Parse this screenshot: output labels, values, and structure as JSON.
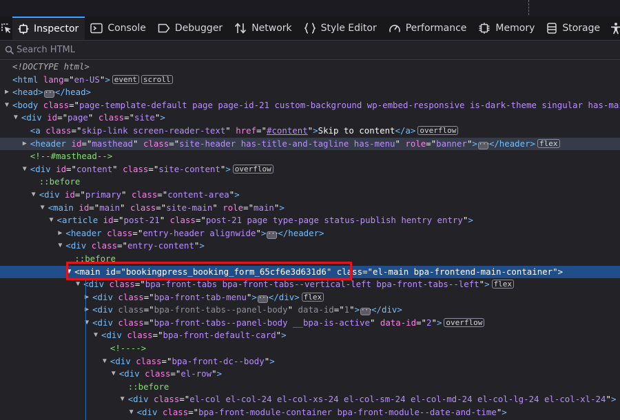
{
  "toolbar": {
    "tabs": [
      {
        "label": "Inspector",
        "icon": "inspector-icon",
        "selected": true
      },
      {
        "label": "Console",
        "icon": "console-icon"
      },
      {
        "label": "Debugger",
        "icon": "debugger-icon"
      },
      {
        "label": "Network",
        "icon": "network-icon"
      },
      {
        "label": "Style Editor",
        "icon": "style-editor-icon"
      },
      {
        "label": "Performance",
        "icon": "performance-icon"
      },
      {
        "label": "Memory",
        "icon": "memory-icon"
      },
      {
        "label": "Storage",
        "icon": "storage-icon"
      }
    ]
  },
  "search": {
    "placeholder": "Search HTML"
  },
  "tree": [
    {
      "indent": 0,
      "twisty": "none",
      "parts": [
        [
          "dt",
          "<!DOCTYPE html>"
        ]
      ]
    },
    {
      "indent": 0,
      "twisty": "none",
      "parts": [
        [
          "tg",
          "<html "
        ],
        [
          "an",
          "lang"
        ],
        [
          "tx",
          "=\""
        ],
        [
          "av",
          "en-US"
        ],
        [
          "tx",
          "\""
        ],
        [
          "tg",
          ">"
        ]
      ],
      "badges": [
        "event",
        "scroll"
      ]
    },
    {
      "indent": 0,
      "twisty": "closed",
      "parts": [
        [
          "tg",
          "<head>"
        ],
        [
          "more",
          ""
        ],
        [
          "tg",
          "</head>"
        ]
      ]
    },
    {
      "indent": 0,
      "twisty": "open",
      "parts": [
        [
          "tg",
          "<body "
        ],
        [
          "an",
          "class"
        ],
        [
          "tx",
          "=\""
        ],
        [
          "av",
          "page-template-default page page-id-21 custom-background wp-embed-responsive is-dark-theme singular has-main-navigation"
        ],
        [
          "tx",
          "\""
        ]
      ]
    },
    {
      "indent": 1,
      "twisty": "open",
      "parts": [
        [
          "tg",
          "<div "
        ],
        [
          "an",
          "id"
        ],
        [
          "tx",
          "=\""
        ],
        [
          "av",
          "page"
        ],
        [
          "tx",
          "\" "
        ],
        [
          "an",
          "class"
        ],
        [
          "tx",
          "=\""
        ],
        [
          "av",
          "site"
        ],
        [
          "tx",
          "\""
        ],
        [
          "tg",
          ">"
        ]
      ]
    },
    {
      "indent": 2,
      "twisty": "none",
      "parts": [
        [
          "tg",
          "<a "
        ],
        [
          "an",
          "class"
        ],
        [
          "tx",
          "=\""
        ],
        [
          "av",
          "skip-link screen-reader-text"
        ],
        [
          "tx",
          "\" "
        ],
        [
          "an",
          "href"
        ],
        [
          "tx",
          "=\""
        ],
        [
          "avu",
          "#content"
        ],
        [
          "tx",
          "\""
        ],
        [
          "tg",
          ">"
        ],
        [
          "tx",
          "Skip to content"
        ],
        [
          "tg",
          "</a>"
        ]
      ],
      "badges": [
        "overflow"
      ]
    },
    {
      "indent": 2,
      "twisty": "closed",
      "hover": true,
      "parts": [
        [
          "tg",
          "<header "
        ],
        [
          "an",
          "id"
        ],
        [
          "tx",
          "=\""
        ],
        [
          "av",
          "masthead"
        ],
        [
          "tx",
          "\" "
        ],
        [
          "an",
          "class"
        ],
        [
          "tx",
          "=\""
        ],
        [
          "av",
          "site-header has-title-and-tagline has-menu"
        ],
        [
          "tx",
          "\" "
        ],
        [
          "an",
          "role"
        ],
        [
          "tx",
          "=\""
        ],
        [
          "av",
          "banner"
        ],
        [
          "tx",
          "\""
        ],
        [
          "tg",
          ">"
        ],
        [
          "more",
          ""
        ],
        [
          "tg",
          "</header>"
        ]
      ],
      "badges": [
        "flex"
      ]
    },
    {
      "indent": 2,
      "twisty": "none",
      "parts": [
        [
          "cm",
          "<!--#masthead-->"
        ]
      ]
    },
    {
      "indent": 2,
      "twisty": "open",
      "parts": [
        [
          "tg",
          "<div "
        ],
        [
          "an",
          "id"
        ],
        [
          "tx",
          "=\""
        ],
        [
          "av",
          "content"
        ],
        [
          "tx",
          "\" "
        ],
        [
          "an",
          "class"
        ],
        [
          "tx",
          "=\""
        ],
        [
          "av",
          "site-content"
        ],
        [
          "tx",
          "\""
        ],
        [
          "tg",
          ">"
        ]
      ],
      "badges": [
        "overflow"
      ]
    },
    {
      "indent": 3,
      "twisty": "none",
      "parts": [
        [
          "ps",
          "::before"
        ]
      ]
    },
    {
      "indent": 3,
      "twisty": "open",
      "parts": [
        [
          "tg",
          "<div "
        ],
        [
          "an",
          "id"
        ],
        [
          "tx",
          "=\""
        ],
        [
          "av",
          "primary"
        ],
        [
          "tx",
          "\" "
        ],
        [
          "an",
          "class"
        ],
        [
          "tx",
          "=\""
        ],
        [
          "av",
          "content-area"
        ],
        [
          "tx",
          "\""
        ],
        [
          "tg",
          ">"
        ]
      ]
    },
    {
      "indent": 4,
      "twisty": "open",
      "parts": [
        [
          "tg",
          "<main "
        ],
        [
          "an",
          "id"
        ],
        [
          "tx",
          "=\""
        ],
        [
          "av",
          "main"
        ],
        [
          "tx",
          "\" "
        ],
        [
          "an",
          "class"
        ],
        [
          "tx",
          "=\""
        ],
        [
          "av",
          "site-main"
        ],
        [
          "tx",
          "\" "
        ],
        [
          "an",
          "role"
        ],
        [
          "tx",
          "=\""
        ],
        [
          "av",
          "main"
        ],
        [
          "tx",
          "\""
        ],
        [
          "tg",
          ">"
        ]
      ]
    },
    {
      "indent": 5,
      "twisty": "open",
      "parts": [
        [
          "tg",
          "<article "
        ],
        [
          "an",
          "id"
        ],
        [
          "tx",
          "=\""
        ],
        [
          "av",
          "post-21"
        ],
        [
          "tx",
          "\" "
        ],
        [
          "an",
          "class"
        ],
        [
          "tx",
          "=\""
        ],
        [
          "av",
          "post-21 page type-page status-publish hentry entry"
        ],
        [
          "tx",
          "\""
        ],
        [
          "tg",
          ">"
        ]
      ]
    },
    {
      "indent": 6,
      "twisty": "closed",
      "parts": [
        [
          "tg",
          "<header "
        ],
        [
          "an",
          "class"
        ],
        [
          "tx",
          "=\""
        ],
        [
          "av",
          "entry-header alignwide"
        ],
        [
          "tx",
          "\""
        ],
        [
          "tg",
          ">"
        ],
        [
          "more",
          ""
        ],
        [
          "tg",
          "</header>"
        ]
      ]
    },
    {
      "indent": 6,
      "twisty": "open",
      "parts": [
        [
          "tg",
          "<div "
        ],
        [
          "an",
          "class"
        ],
        [
          "tx",
          "=\""
        ],
        [
          "av",
          "entry-content"
        ],
        [
          "tx",
          "\""
        ],
        [
          "tg",
          ">"
        ]
      ]
    },
    {
      "indent": 7,
      "twisty": "none",
      "parts": [
        [
          "ps",
          "::before"
        ]
      ]
    },
    {
      "indent": 7,
      "twisty": "open",
      "selected": true,
      "parts": [
        [
          "tg",
          "<main "
        ],
        [
          "an",
          "id"
        ],
        [
          "tx",
          "=\""
        ],
        [
          "av",
          "bookingpress_booking_form_65cf6e3d631d6"
        ],
        [
          "tx",
          "\" "
        ],
        [
          "an",
          "class"
        ],
        [
          "tx",
          "=\""
        ],
        [
          "av",
          "el-main bpa-frontend-main-container"
        ],
        [
          "tx",
          "\""
        ],
        [
          "tg",
          ">"
        ]
      ]
    },
    {
      "indent": 8,
      "twisty": "open",
      "parts": [
        [
          "tg",
          "<div "
        ],
        [
          "an",
          "class"
        ],
        [
          "tx",
          "=\""
        ],
        [
          "av",
          "bpa-front-tabs bpa-front-tabs--vertical-left bpa-front-tabs--left"
        ],
        [
          "tx",
          "\""
        ],
        [
          "tg",
          ">"
        ]
      ],
      "badges": [
        "flex"
      ]
    },
    {
      "indent": 9,
      "twisty": "closed",
      "parts": [
        [
          "tg",
          "<div "
        ],
        [
          "an",
          "class"
        ],
        [
          "tx",
          "=\""
        ],
        [
          "av",
          "bpa-front-tab-menu"
        ],
        [
          "tx",
          "\""
        ],
        [
          "tg",
          ">"
        ],
        [
          "more",
          ""
        ],
        [
          "tg",
          "</div>"
        ]
      ],
      "badges": [
        "flex"
      ]
    },
    {
      "indent": 9,
      "twisty": "closed",
      "dim": true,
      "parts": [
        [
          "tg",
          "<div "
        ],
        [
          "an",
          "class"
        ],
        [
          "tx",
          "=\""
        ],
        [
          "av",
          "bpa-front-tabs--panel-body"
        ],
        [
          "tx",
          "\" "
        ],
        [
          "an",
          "data-id"
        ],
        [
          "tx",
          "=\""
        ],
        [
          "av",
          "1"
        ],
        [
          "tx",
          "\""
        ],
        [
          "tg",
          ">"
        ],
        [
          "more",
          ""
        ],
        [
          "tg",
          "</div>"
        ]
      ]
    },
    {
      "indent": 9,
      "twisty": "open",
      "parts": [
        [
          "tg",
          "<div "
        ],
        [
          "an",
          "class"
        ],
        [
          "tx",
          "=\""
        ],
        [
          "av",
          "bpa-front-tabs--panel-body __bpa-is-active"
        ],
        [
          "tx",
          "\" "
        ],
        [
          "an",
          "data-id"
        ],
        [
          "tx",
          "=\""
        ],
        [
          "av",
          "2"
        ],
        [
          "tx",
          "\""
        ],
        [
          "tg",
          ">"
        ]
      ],
      "badges": [
        "overflow"
      ]
    },
    {
      "indent": 10,
      "twisty": "open",
      "parts": [
        [
          "tg",
          "<div "
        ],
        [
          "an",
          "class"
        ],
        [
          "tx",
          "=\""
        ],
        [
          "av",
          "bpa-front-default-card"
        ],
        [
          "tx",
          "\""
        ],
        [
          "tg",
          ">"
        ]
      ]
    },
    {
      "indent": 11,
      "twisty": "none",
      "parts": [
        [
          "cm",
          "<!---->"
        ]
      ]
    },
    {
      "indent": 11,
      "twisty": "open",
      "parts": [
        [
          "tg",
          "<div "
        ],
        [
          "an",
          "class"
        ],
        [
          "tx",
          "=\""
        ],
        [
          "av",
          "bpa-front-dc--body"
        ],
        [
          "tx",
          "\""
        ],
        [
          "tg",
          ">"
        ]
      ]
    },
    {
      "indent": 12,
      "twisty": "open",
      "parts": [
        [
          "tg",
          "<div "
        ],
        [
          "an",
          "class"
        ],
        [
          "tx",
          "=\""
        ],
        [
          "av",
          "el-row"
        ],
        [
          "tx",
          "\""
        ],
        [
          "tg",
          ">"
        ]
      ]
    },
    {
      "indent": 13,
      "twisty": "none",
      "parts": [
        [
          "ps",
          "::before"
        ]
      ]
    },
    {
      "indent": 13,
      "twisty": "open",
      "parts": [
        [
          "tg",
          "<div "
        ],
        [
          "an",
          "class"
        ],
        [
          "tx",
          "=\""
        ],
        [
          "av",
          "el-col el-col-24 el-col-xs-24 el-col-sm-24 el-col-md-24 el-col-lg-24 el-col-xl-24"
        ],
        [
          "tx",
          "\""
        ],
        [
          "tg",
          ">"
        ]
      ]
    },
    {
      "indent": 14,
      "twisty": "open",
      "parts": [
        [
          "tg",
          "<div "
        ],
        [
          "an",
          "class"
        ],
        [
          "tx",
          "=\""
        ],
        [
          "av",
          "bpa-front-module-container bpa-front-module--date-and-time"
        ],
        [
          "tx",
          "\""
        ],
        [
          "tg",
          ">"
        ]
      ]
    }
  ]
}
